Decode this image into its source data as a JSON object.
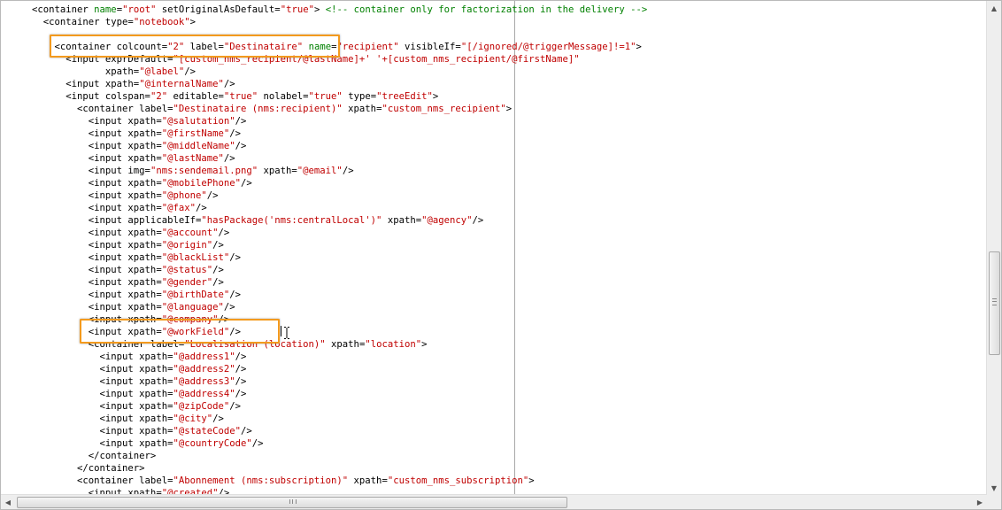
{
  "editor": {
    "lines": [
      [
        [
          "<container ",
          "c-tag"
        ],
        [
          "name",
          "c-name"
        ],
        [
          "=",
          "c-tag"
        ],
        [
          "\"root\"",
          "c-val"
        ],
        [
          " setOriginalAsDefault=",
          "c-attr"
        ],
        [
          "\"true\"",
          "c-val"
        ],
        [
          "> ",
          "c-tag"
        ],
        [
          "<!-- container only for factorization in the delivery -->",
          "c-cmt"
        ]
      ],
      [
        [
          "  <container type=",
          "c-tag"
        ],
        [
          "\"notebook\"",
          "c-val"
        ],
        [
          ">",
          "c-tag"
        ]
      ],
      [
        [
          "",
          ""
        ]
      ],
      [
        [
          "    <container colcount=",
          "c-tag"
        ],
        [
          "\"2\"",
          "c-val"
        ],
        [
          " label=",
          "c-attr"
        ],
        [
          "\"Destinataire\"",
          "c-val"
        ],
        [
          " ",
          "c-attr"
        ],
        [
          "name",
          "c-name"
        ],
        [
          "=",
          "c-attr"
        ],
        [
          "\"recipient\"",
          "c-val"
        ],
        [
          " visibleIf=",
          "c-attr"
        ],
        [
          "\"[/ignored/@triggerMessage]!=1\"",
          "c-val"
        ],
        [
          ">",
          "c-tag"
        ]
      ],
      [
        [
          "      <input exprDefault=",
          "c-tag"
        ],
        [
          "\"[custom_nms_recipient/@lastName]+' '+[custom_nms_recipient/@firstName]\"",
          "c-val"
        ]
      ],
      [
        [
          "             xpath=",
          "c-attr"
        ],
        [
          "\"@label\"",
          "c-val"
        ],
        [
          "/>",
          "c-tag"
        ]
      ],
      [
        [
          "      <input xpath=",
          "c-tag"
        ],
        [
          "\"@internalName\"",
          "c-val"
        ],
        [
          "/>",
          "c-tag"
        ]
      ],
      [
        [
          "      <input colspan=",
          "c-tag"
        ],
        [
          "\"2\"",
          "c-val"
        ],
        [
          " editable=",
          "c-attr"
        ],
        [
          "\"true\"",
          "c-val"
        ],
        [
          " nolabel=",
          "c-attr"
        ],
        [
          "\"true\"",
          "c-val"
        ],
        [
          " type=",
          "c-attr"
        ],
        [
          "\"treeEdit\"",
          "c-val"
        ],
        [
          ">",
          "c-tag"
        ]
      ],
      [
        [
          "        <container label=",
          "c-tag"
        ],
        [
          "\"Destinataire (nms:recipient)\"",
          "c-val"
        ],
        [
          " xpath=",
          "c-attr"
        ],
        [
          "\"custom_nms_recipient\"",
          "c-val"
        ],
        [
          ">",
          "c-tag"
        ]
      ],
      [
        [
          "          <input xpath=",
          "c-tag"
        ],
        [
          "\"@salutation\"",
          "c-val"
        ],
        [
          "/>",
          "c-tag"
        ]
      ],
      [
        [
          "          <input xpath=",
          "c-tag"
        ],
        [
          "\"@firstName\"",
          "c-val"
        ],
        [
          "/>",
          "c-tag"
        ]
      ],
      [
        [
          "          <input xpath=",
          "c-tag"
        ],
        [
          "\"@middleName\"",
          "c-val"
        ],
        [
          "/>",
          "c-tag"
        ]
      ],
      [
        [
          "          <input xpath=",
          "c-tag"
        ],
        [
          "\"@lastName\"",
          "c-val"
        ],
        [
          "/>",
          "c-tag"
        ]
      ],
      [
        [
          "          <input img=",
          "c-tag"
        ],
        [
          "\"nms:sendemail.png\"",
          "c-val"
        ],
        [
          " xpath=",
          "c-attr"
        ],
        [
          "\"@email\"",
          "c-val"
        ],
        [
          "/>",
          "c-tag"
        ]
      ],
      [
        [
          "          <input xpath=",
          "c-tag"
        ],
        [
          "\"@mobilePhone\"",
          "c-val"
        ],
        [
          "/>",
          "c-tag"
        ]
      ],
      [
        [
          "          <input xpath=",
          "c-tag"
        ],
        [
          "\"@phone\"",
          "c-val"
        ],
        [
          "/>",
          "c-tag"
        ]
      ],
      [
        [
          "          <input xpath=",
          "c-tag"
        ],
        [
          "\"@fax\"",
          "c-val"
        ],
        [
          "/>",
          "c-tag"
        ]
      ],
      [
        [
          "          <input applicableIf=",
          "c-tag"
        ],
        [
          "\"hasPackage('nms:centralLocal')\"",
          "c-val"
        ],
        [
          " xpath=",
          "c-attr"
        ],
        [
          "\"@agency\"",
          "c-val"
        ],
        [
          "/>",
          "c-tag"
        ]
      ],
      [
        [
          "          <input xpath=",
          "c-tag"
        ],
        [
          "\"@account\"",
          "c-val"
        ],
        [
          "/>",
          "c-tag"
        ]
      ],
      [
        [
          "          <input xpath=",
          "c-tag"
        ],
        [
          "\"@origin\"",
          "c-val"
        ],
        [
          "/>",
          "c-tag"
        ]
      ],
      [
        [
          "          <input xpath=",
          "c-tag"
        ],
        [
          "\"@blackList\"",
          "c-val"
        ],
        [
          "/>",
          "c-tag"
        ]
      ],
      [
        [
          "          <input xpath=",
          "c-tag"
        ],
        [
          "\"@status\"",
          "c-val"
        ],
        [
          "/>",
          "c-tag"
        ]
      ],
      [
        [
          "          <input xpath=",
          "c-tag"
        ],
        [
          "\"@gender\"",
          "c-val"
        ],
        [
          "/>",
          "c-tag"
        ]
      ],
      [
        [
          "          <input xpath=",
          "c-tag"
        ],
        [
          "\"@birthDate\"",
          "c-val"
        ],
        [
          "/>",
          "c-tag"
        ]
      ],
      [
        [
          "          <input xpath=",
          "c-tag"
        ],
        [
          "\"@language\"",
          "c-val"
        ],
        [
          "/>",
          "c-tag"
        ]
      ],
      [
        [
          "          <input xpath=",
          "c-tag"
        ],
        [
          "\"@company\"",
          "c-val"
        ],
        [
          "/>",
          "c-tag"
        ]
      ],
      [
        [
          "          <input xpath=",
          "c-tag"
        ],
        [
          "\"@workField\"",
          "c-val"
        ],
        [
          "/>",
          "c-tag"
        ]
      ],
      [
        [
          "          <container label=",
          "c-tag"
        ],
        [
          "\"Localisation (location)\"",
          "c-val"
        ],
        [
          " xpath=",
          "c-attr"
        ],
        [
          "\"location\"",
          "c-val"
        ],
        [
          ">",
          "c-tag"
        ]
      ],
      [
        [
          "            <input xpath=",
          "c-tag"
        ],
        [
          "\"@address1\"",
          "c-val"
        ],
        [
          "/>",
          "c-tag"
        ]
      ],
      [
        [
          "            <input xpath=",
          "c-tag"
        ],
        [
          "\"@address2\"",
          "c-val"
        ],
        [
          "/>",
          "c-tag"
        ]
      ],
      [
        [
          "            <input xpath=",
          "c-tag"
        ],
        [
          "\"@address3\"",
          "c-val"
        ],
        [
          "/>",
          "c-tag"
        ]
      ],
      [
        [
          "            <input xpath=",
          "c-tag"
        ],
        [
          "\"@address4\"",
          "c-val"
        ],
        [
          "/>",
          "c-tag"
        ]
      ],
      [
        [
          "            <input xpath=",
          "c-tag"
        ],
        [
          "\"@zipCode\"",
          "c-val"
        ],
        [
          "/>",
          "c-tag"
        ]
      ],
      [
        [
          "            <input xpath=",
          "c-tag"
        ],
        [
          "\"@city\"",
          "c-val"
        ],
        [
          "/>",
          "c-tag"
        ]
      ],
      [
        [
          "            <input xpath=",
          "c-tag"
        ],
        [
          "\"@stateCode\"",
          "c-val"
        ],
        [
          "/>",
          "c-tag"
        ]
      ],
      [
        [
          "            <input xpath=",
          "c-tag"
        ],
        [
          "\"@countryCode\"",
          "c-val"
        ],
        [
          "/>",
          "c-tag"
        ]
      ],
      [
        [
          "          </container>",
          "c-tag"
        ]
      ],
      [
        [
          "        </container>",
          "c-tag"
        ]
      ],
      [
        [
          "        <container label=",
          "c-tag"
        ],
        [
          "\"Abonnement (nms:subscription)\"",
          "c-val"
        ],
        [
          " xpath=",
          "c-attr"
        ],
        [
          "\"custom_nms_subscription\"",
          "c-val"
        ],
        [
          ">",
          "c-tag"
        ]
      ],
      [
        [
          "          <input xpath=",
          "c-tag"
        ],
        [
          "\"@created\"",
          "c-val"
        ],
        [
          "/>",
          "c-tag"
        ]
      ]
    ]
  },
  "scrollbars": {
    "up_glyph": "▲",
    "down_glyph": "▼",
    "left_glyph": "◀",
    "right_glyph": "▶"
  }
}
